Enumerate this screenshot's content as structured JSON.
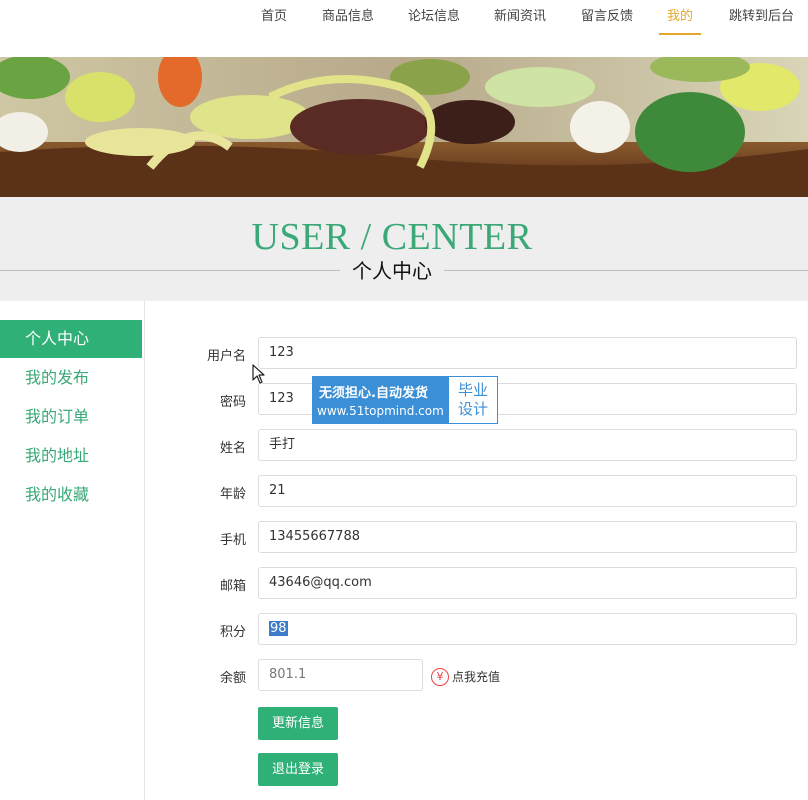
{
  "nav": {
    "items": [
      {
        "label": "首页"
      },
      {
        "label": "商品信息"
      },
      {
        "label": "论坛信息"
      },
      {
        "label": "新闻资讯"
      },
      {
        "label": "留言反馈"
      },
      {
        "label": "我的",
        "active": true
      },
      {
        "label": "跳转到后台"
      }
    ],
    "accent_color": "#e4a82a"
  },
  "title": {
    "en": "USER / CENTER",
    "cn": "个人中心"
  },
  "sidebar": {
    "items": [
      {
        "label": "个人中心",
        "active": true
      },
      {
        "label": "我的发布"
      },
      {
        "label": "我的订单"
      },
      {
        "label": "我的地址"
      },
      {
        "label": "我的收藏"
      }
    ],
    "accent_color": "#2fb077"
  },
  "form": {
    "fields": [
      {
        "label": "用户名",
        "value": "123"
      },
      {
        "label": "密码",
        "value": "123"
      },
      {
        "label": "姓名",
        "value": "手打"
      },
      {
        "label": "年龄",
        "value": "21"
      },
      {
        "label": "手机",
        "value": "13455667788"
      },
      {
        "label": "邮箱",
        "value": "43646@qq.com"
      },
      {
        "label": "积分",
        "value": "98"
      },
      {
        "label": "余额",
        "value": "801.1"
      }
    ],
    "recharge": {
      "icon": "yen-icon",
      "label": "点我充值"
    },
    "update_button": "更新信息",
    "logout_button": "退出登录"
  },
  "watermark": {
    "line1": "无须担心.自动发货",
    "line2": "www.51topmind.com",
    "badge_line1": "毕业",
    "badge_line2": "设计"
  }
}
